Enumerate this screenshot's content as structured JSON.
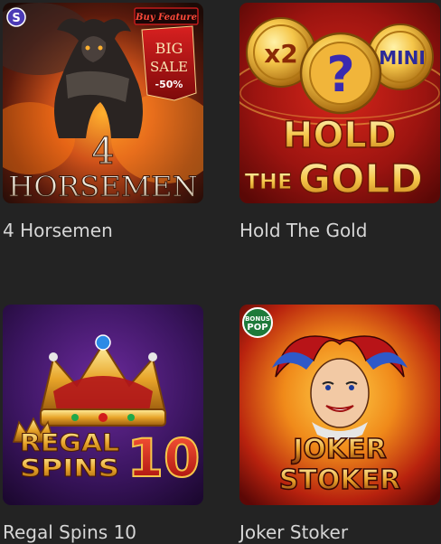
{
  "games": [
    {
      "title": "4 Horsemen",
      "art": {
        "main_line1": "4",
        "main_line2": "HORSEMEN",
        "badge": "Buy Feature",
        "sale_line1": "BIG",
        "sale_line2": "SALE",
        "sale_discount": "-50%",
        "provider_mark": "S"
      }
    },
    {
      "title": "Hold The Gold",
      "art": {
        "main_line1": "HOLD",
        "main_line2_small": "THE",
        "main_line2_big": "GOLD",
        "coin_left": "x2",
        "coin_center": "?",
        "coin_right": "MINI"
      }
    },
    {
      "title": "Regal Spins 10",
      "art": {
        "main_line1": "REGAL",
        "main_line2": "SPINS",
        "number": "10"
      }
    },
    {
      "title": "Joker Stoker",
      "art": {
        "main_line1": "JOKER",
        "main_line2": "STOKER",
        "badge_line1": "BONUS",
        "badge_line2": "POP"
      }
    }
  ],
  "colors": {
    "background": "#232323",
    "title_text": "#d6d6d6",
    "gold": "#f5c64a",
    "deep_red": "#9c1410",
    "purple": "#3b1560"
  }
}
